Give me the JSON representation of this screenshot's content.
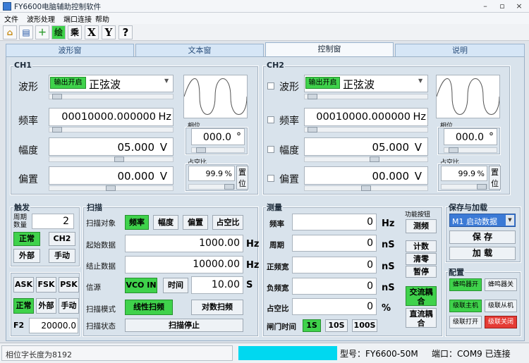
{
  "window": {
    "title": "FY6600电脑辅助控制软件",
    "min": "–",
    "restore": "▫",
    "close": "×"
  },
  "menu": [
    "文件",
    "波形处理",
    "端口连接",
    "帮助"
  ],
  "toolbar": [
    "⌂",
    "▤",
    "＋",
    "绘",
    "乘",
    "X",
    "Y",
    "?"
  ],
  "tabs": [
    "波形窗",
    "文本窗",
    "控制窗",
    "说明"
  ],
  "ch1": {
    "title": "CH1",
    "wave_label": "波形",
    "output_btn": "输出开启",
    "wave_value": "正弦波",
    "freq_label": "频率",
    "freq_value": "00010000.000000",
    "freq_unit": "Hz",
    "amp_label": "幅度",
    "amp_value": "05.000",
    "amp_unit": "V",
    "offset_label": "偏置",
    "offset_value": "00.000",
    "offset_unit": "V",
    "phase_label": "相位",
    "phase_value": "000.0",
    "phase_unit": "°",
    "duty_label": "占空比",
    "duty_value": "99.9",
    "duty_unit": "%",
    "reset_btn": "置位"
  },
  "ch2": {
    "title": "CH2",
    "wave_label": "波形",
    "output_btn": "输出开启",
    "wave_value": "正弦波",
    "freq_label": "频率",
    "freq_value": "00010000.000000",
    "freq_unit": "Hz",
    "amp_label": "幅度",
    "amp_value": "05.000",
    "amp_unit": "V",
    "offset_label": "偏置",
    "offset_value": "00.000",
    "offset_unit": "V",
    "phase_label": "相位",
    "phase_value": "000.0",
    "phase_unit": "°",
    "duty_label": "占空比",
    "duty_value": "99.9",
    "duty_unit": "%",
    "reset_btn": "置位"
  },
  "trigger": {
    "title": "触发",
    "cycles_label": "周期数量",
    "cycles_value": "2",
    "btn_normal": "正常",
    "btn_ch2": "CH2",
    "btn_external": "外部",
    "btn_manual": "手动"
  },
  "modulation": {
    "ask": "ASK",
    "fsk": "FSK",
    "psk": "PSK",
    "normal": "正常",
    "external": "外部",
    "manual": "手动",
    "f2_label": "F2",
    "f2_value": "20000.0"
  },
  "sweep": {
    "title": "扫描",
    "target_label": "扫描对象",
    "t_freq": "频率",
    "t_amp": "幅度",
    "t_offset": "偏置",
    "t_duty": "占空比",
    "start_label": "起始数据",
    "start_value": "1000.00",
    "start_unit": "Hz",
    "end_label": "结止数据",
    "end_value": "10000.00",
    "end_unit": "Hz",
    "source_label": "信源",
    "src_vco": "VCO IN",
    "src_time": "时间",
    "time_value": "10.00",
    "time_unit": "S",
    "mode_label": "扫描模式",
    "mode_linear": "线性扫频",
    "mode_log": "对数扫频",
    "state_label": "扫描状态",
    "state_btn": "扫描停止"
  },
  "measure": {
    "title": "测量",
    "func_title": "功能按钮",
    "rows": [
      {
        "label": "频率",
        "value": "0",
        "unit": "Hz"
      },
      {
        "label": "周期",
        "value": "0",
        "unit": "nS"
      },
      {
        "label": "正频宽",
        "value": "0",
        "unit": "nS"
      },
      {
        "label": "负频宽",
        "value": "0",
        "unit": "nS"
      },
      {
        "label": "占空比",
        "value": "0",
        "unit": "%"
      }
    ],
    "btn_measure": "测频",
    "btn_count": "计数",
    "btn_clear": "清零",
    "btn_pause": "暂停",
    "btn_ac": "交流耦合",
    "btn_dc": "直流耦合",
    "gate_label": "闸门时间",
    "gate_1s": "1S",
    "gate_10s": "10S",
    "gate_100s": "100S"
  },
  "save": {
    "title": "保存与加载",
    "preset": "M1 启动数据",
    "save_btn": "保 存",
    "load_btn": "加 载"
  },
  "config": {
    "title": "配置",
    "buzzer_on": "蜂鸣器开",
    "buzzer_off": "蜂鸣器关",
    "cascade_master": "级联主机",
    "cascade_slave": "级联从机",
    "cascade_open": "级联打开",
    "cascade_close": "级联关闭"
  },
  "status": {
    "left": "相位字长度为8192",
    "model": "型号：FY6600-50M",
    "port": "端口：COM9 已连接"
  },
  "colors": {
    "green": "#3fd24b",
    "red": "#e53b35",
    "cyan": "#00d8f0"
  }
}
